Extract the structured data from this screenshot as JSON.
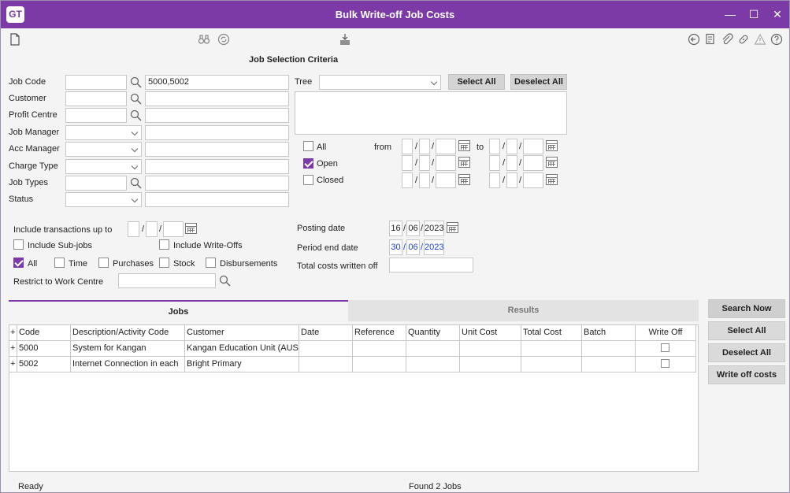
{
  "window": {
    "logo": "GT",
    "title": "Bulk Write-off Job Costs",
    "controls": {
      "minimize": "—",
      "maximize": "☐",
      "close": "✕"
    }
  },
  "toolbar": {
    "left_icons": [
      "new-document-icon"
    ],
    "middle_icons": [
      "binoculars-icon",
      "refresh-icon",
      "export-icon"
    ],
    "right_icons": [
      "back-icon",
      "notes-icon",
      "attach-icon",
      "link-icon",
      "alert-icon",
      "help-icon"
    ]
  },
  "section_title": "Job Selection Criteria",
  "criteria": {
    "job_code": {
      "label": "Job Code",
      "value": "",
      "description": "5000,5002"
    },
    "customer": {
      "label": "Customer",
      "value": "",
      "description": ""
    },
    "profit_centre": {
      "label": "Profit Centre",
      "value": "",
      "description": ""
    },
    "job_manager": {
      "label": "Job Manager",
      "value": "",
      "description": ""
    },
    "acc_manager": {
      "label": "Acc Manager",
      "value": "",
      "description": ""
    },
    "charge_type": {
      "label": "Charge Type",
      "value": "",
      "description": ""
    },
    "job_types": {
      "label": "Job Types",
      "value": "",
      "description": ""
    },
    "status": {
      "label": "Status",
      "value": "",
      "description": ""
    }
  },
  "tree": {
    "label": "Tree",
    "value": "",
    "select_all": "Select All",
    "deselect_all": "Deselect All"
  },
  "job_status": {
    "all": {
      "label": "All",
      "checked": false
    },
    "open": {
      "label": "Open",
      "checked": true
    },
    "closed": {
      "label": "Closed",
      "checked": false
    },
    "from_label": "from",
    "to_label": "to"
  },
  "transactions": {
    "include_up_to_label": "Include transactions up to",
    "include_sub_jobs": "Include Sub-jobs",
    "include_write_offs": "Include Write-Offs",
    "types": [
      {
        "label": "All",
        "checked": true
      },
      {
        "label": "Time",
        "checked": false
      },
      {
        "label": "Purchases",
        "checked": false
      },
      {
        "label": "Stock",
        "checked": false
      },
      {
        "label": "Disbursements",
        "checked": false
      }
    ],
    "restrict_label": "Restrict to Work Centre",
    "restrict_value": ""
  },
  "posting": {
    "posting_date_label": "Posting date",
    "posting_date": {
      "day": "16",
      "month": "06",
      "year": "2023"
    },
    "period_end_label": "Period end date",
    "period_end": {
      "day": "30",
      "month": "06",
      "year": "2023"
    },
    "total_costs_label": "Total costs written off",
    "total_costs_value": ""
  },
  "tabs": [
    "Jobs",
    "Results"
  ],
  "table": {
    "columns": [
      "Code",
      "Description/Activity Code",
      "Customer",
      "Date",
      "Reference",
      "Quantity",
      "Unit Cost",
      "Total Cost",
      "Batch",
      "Write Off"
    ],
    "rows": [
      {
        "expander": "+",
        "code": "5000",
        "description": "System for Kangan",
        "customer": "Kangan Education Unit (AUST)",
        "date": "",
        "reference": "",
        "quantity": "",
        "unit_cost": "",
        "total_cost": "",
        "batch": "",
        "write_off": false
      },
      {
        "expander": "+",
        "code": "5002",
        "description": "Internet Connection in each",
        "customer": "Bright Primary",
        "date": "",
        "reference": "",
        "quantity": "",
        "unit_cost": "",
        "total_cost": "",
        "batch": "",
        "write_off": false
      }
    ]
  },
  "actions": {
    "search_now": "Search Now",
    "select_all": "Select All",
    "deselect_all": "Deselect All",
    "write_off_costs": "Write off costs"
  },
  "statusbar": {
    "left": "Ready",
    "center": "Found 2 Jobs"
  },
  "colors": {
    "accent": "#7b3aa5",
    "blue_text": "#1f3fdc"
  }
}
